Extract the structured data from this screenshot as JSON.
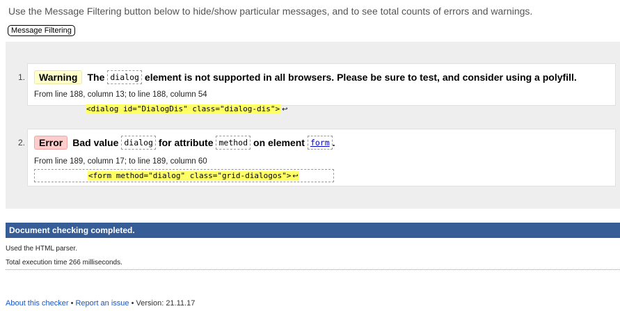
{
  "intro": {
    "text": "Use the Message Filtering button below to hide/show particular messages, and to see total counts of errors and warnings.",
    "filter_button": "Message Filtering"
  },
  "messages": [
    {
      "number": "1.",
      "type_label": "Warning",
      "parts": [
        "The",
        "dialog",
        "element is not supported in all browsers. Please be sure to test, and consider using a polyfill."
      ],
      "location": "From line 188, column 13; to line 188, column 54",
      "extract": "<dialog id=\"DialogDis\" class=\"dialog-dis\">",
      "return_symbol": "↩"
    },
    {
      "number": "2.",
      "type_label": "Error",
      "parts": [
        "Bad value",
        "dialog",
        "for attribute",
        "method",
        "on element",
        "form",
        "."
      ],
      "location": "From line 189, column 17; to line 189, column 60",
      "extract": "<form method=\"dialog\" class=\"grid-dialogos\">",
      "return_symbol": "↩"
    }
  ],
  "status": {
    "title": "Document checking completed.",
    "parser": "Used the HTML parser.",
    "time": "Total execution time 266 milliseconds."
  },
  "footer": {
    "about": "About this checker",
    "bullet": "•",
    "report": "Report an issue",
    "version": "Version: 21.11.17"
  },
  "colors": {
    "status_bar": "#365d95",
    "warning_badge": "#ffffcc",
    "error_badge": "#ffcccc",
    "highlight": "#ffff66",
    "link": "#1a56c8"
  }
}
